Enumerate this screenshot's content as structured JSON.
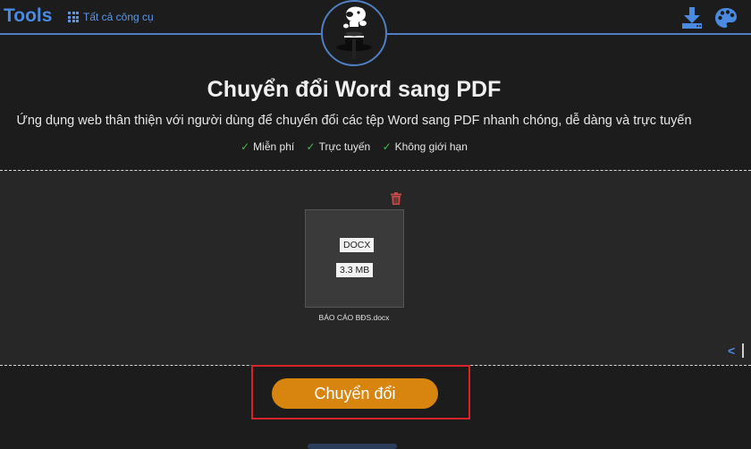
{
  "header": {
    "brand": "Tools",
    "all_tools_label": "Tất cả công cụ",
    "icons": [
      "grid-icon",
      "download-icon",
      "palette-icon",
      "magician-logo"
    ]
  },
  "main": {
    "title": "Chuyển đổi Word sang PDF",
    "subtitle": "Ứng dụng web thân thiện với người dùng để chuyển đổi các tệp Word sang PDF nhanh chóng, dễ dàng và trực tuyến",
    "features": [
      "Miễn phí",
      "Trực tuyến",
      "Không giới hạn"
    ]
  },
  "upload": {
    "file": {
      "type": "DOCX",
      "size": "3.3 MB",
      "name": "BÁO CÁO BĐS.docx"
    }
  },
  "convert": {
    "label": "Chuyển đổi"
  },
  "colors": {
    "accent": "#4a8ae0",
    "button": "#d8850f",
    "check": "#3fbf4a",
    "highlight": "#d9232a",
    "trash": "#c94a4a"
  }
}
